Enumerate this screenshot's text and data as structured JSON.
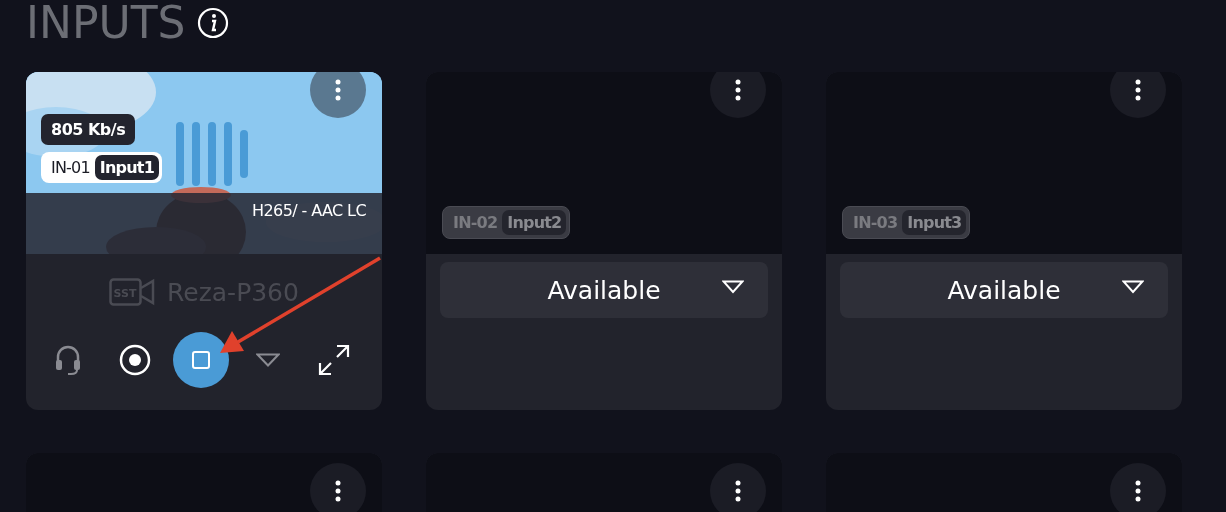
{
  "header": {
    "title": "INPUTS"
  },
  "inputs": [
    {
      "kind": "live",
      "id": "IN-01",
      "name": "Input1",
      "bitrate": "805 Kb/s",
      "codec": "H265/ - AAC LC",
      "device": "Reza-P360",
      "device_logo": "SST",
      "device_disabled": true,
      "controls": [
        {
          "kind": "headset",
          "selected": false
        },
        {
          "kind": "record",
          "selected": false
        },
        {
          "kind": "stop",
          "selected": true
        },
        {
          "kind": "caret",
          "selected": false
        },
        {
          "kind": "expand",
          "selected": false
        }
      ]
    },
    {
      "kind": "idle",
      "id": "IN-02",
      "name": "Input2",
      "status": "Available"
    },
    {
      "kind": "idle",
      "id": "IN-03",
      "name": "Input3",
      "status": "Available"
    },
    {
      "kind": "empty"
    },
    {
      "kind": "empty"
    },
    {
      "kind": "empty"
    }
  ],
  "annotation": {
    "kind": "arrow"
  }
}
